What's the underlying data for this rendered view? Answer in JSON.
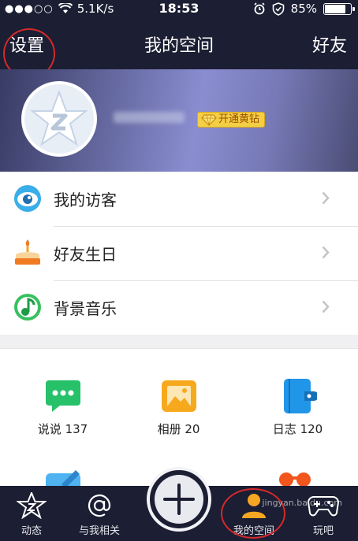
{
  "status_bar": {
    "network": "5.1K/s",
    "time": "18:53",
    "battery_percent": "85%",
    "battery_level": 0.85
  },
  "nav": {
    "left": "设置",
    "title": "我的空间",
    "right": "好友"
  },
  "profile": {
    "vip_badge": "开通黄钻"
  },
  "list": [
    {
      "label": "我的访客",
      "icon": "visitor-eye-icon"
    },
    {
      "label": "好友生日",
      "icon": "birthday-cake-icon"
    },
    {
      "label": "背景音乐",
      "icon": "music-note-icon"
    }
  ],
  "grid": [
    {
      "label": "说说 137",
      "icon": "chat-bubble-icon"
    },
    {
      "label": "相册 20",
      "icon": "photo-album-icon"
    },
    {
      "label": "日志 120",
      "icon": "journal-icon"
    }
  ],
  "tabbar": [
    {
      "label": "动态",
      "icon": "feed-icon"
    },
    {
      "label": "与我相关",
      "icon": "at-icon"
    },
    {
      "label": "我的空间",
      "icon": "person-icon"
    },
    {
      "label": "玩吧",
      "icon": "gamepad-icon"
    }
  ],
  "watermark": "jingyan.baidu.com",
  "colors": {
    "dark_bar": "#1c1e33",
    "accent_orange": "#f5a623",
    "annotation_red": "#d42a2a"
  }
}
